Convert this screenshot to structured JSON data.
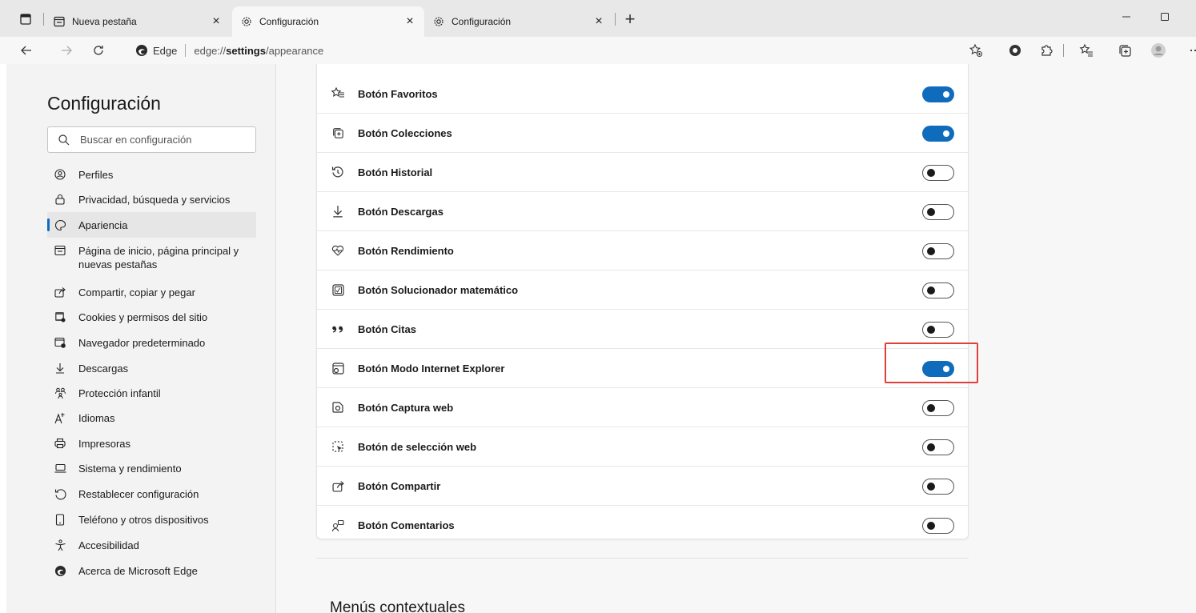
{
  "tabs": [
    {
      "title": "Nueva pestaña",
      "icon": "newtab-icon",
      "active": false
    },
    {
      "title": "Configuración",
      "icon": "gear-icon",
      "active": true
    },
    {
      "title": "Configuración",
      "icon": "gear-icon",
      "active": false
    }
  ],
  "address": {
    "brand": "Edge",
    "url_prefix": "edge://",
    "url_bold": "settings",
    "url_suffix": "/appearance"
  },
  "sidebar": {
    "title": "Configuración",
    "search_placeholder": "Buscar en configuración",
    "items": [
      {
        "label": "Perfiles",
        "icon": "profile-icon"
      },
      {
        "label": "Privacidad, búsqueda y servicios",
        "icon": "lock-icon"
      },
      {
        "label": "Apariencia",
        "icon": "palette-icon",
        "selected": true
      },
      {
        "label": "Página de inicio, página principal y nuevas pestañas",
        "icon": "home-tab-icon"
      },
      {
        "label": "Compartir, copiar y pegar",
        "icon": "share-icon"
      },
      {
        "label": "Cookies y permisos del sitio",
        "icon": "cookies-icon"
      },
      {
        "label": "Navegador predeterminado",
        "icon": "default-browser-icon"
      },
      {
        "label": "Descargas",
        "icon": "download-icon"
      },
      {
        "label": "Protección infantil",
        "icon": "family-icon"
      },
      {
        "label": "Idiomas",
        "icon": "language-icon"
      },
      {
        "label": "Impresoras",
        "icon": "printer-icon"
      },
      {
        "label": "Sistema y rendimiento",
        "icon": "laptop-icon"
      },
      {
        "label": "Restablecer configuración",
        "icon": "reset-icon"
      },
      {
        "label": "Teléfono y otros dispositivos",
        "icon": "phone-icon"
      },
      {
        "label": "Accesibilidad",
        "icon": "accessibility-icon"
      },
      {
        "label": "Acerca de Microsoft Edge",
        "icon": "edge-logo-icon"
      }
    ]
  },
  "settings_rows": [
    {
      "label": "Botón Favoritos",
      "icon": "favorites-icon",
      "enabled": true
    },
    {
      "label": "Botón Colecciones",
      "icon": "collections-icon",
      "enabled": true
    },
    {
      "label": "Botón Historial",
      "icon": "history-icon",
      "enabled": false
    },
    {
      "label": "Botón Descargas",
      "icon": "download-icon",
      "enabled": false
    },
    {
      "label": "Botón Rendimiento",
      "icon": "performance-icon",
      "enabled": false
    },
    {
      "label": "Botón Solucionador matemático",
      "icon": "math-solver-icon",
      "enabled": false
    },
    {
      "label": "Botón Citas",
      "icon": "quotes-icon",
      "enabled": false
    },
    {
      "label": "Botón Modo Internet Explorer",
      "icon": "ie-mode-icon",
      "enabled": true,
      "highlighted": true
    },
    {
      "label": "Botón Captura web",
      "icon": "web-capture-icon",
      "enabled": false
    },
    {
      "label": "Botón de selección web",
      "icon": "web-select-icon",
      "enabled": false
    },
    {
      "label": "Botón Compartir",
      "icon": "share-icon",
      "enabled": false
    },
    {
      "label": "Botón Comentarios",
      "icon": "feedback-icon",
      "enabled": false
    }
  ],
  "next_section_title": "Menús contextuales",
  "colors": {
    "accent": "#0f6cbd",
    "highlight_border": "#e0403a"
  }
}
